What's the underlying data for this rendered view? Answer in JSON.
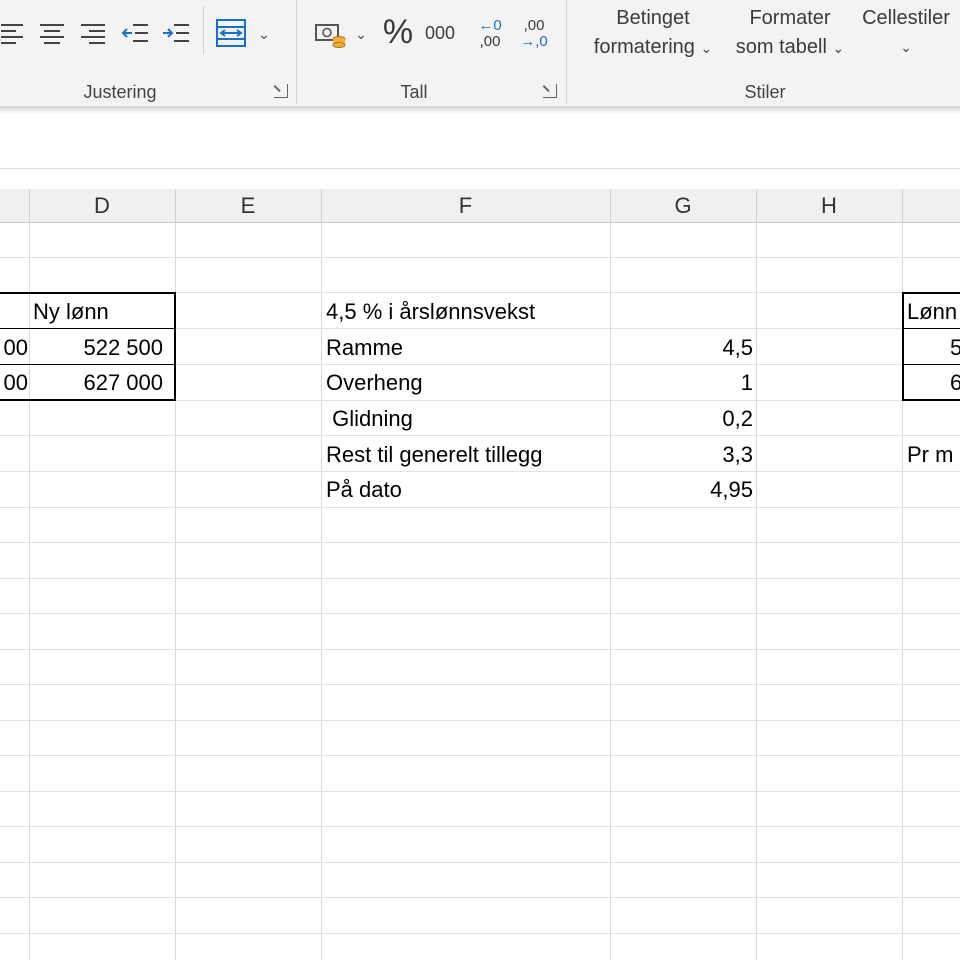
{
  "ribbon": {
    "groups": {
      "justering": "Justering",
      "tall": "Tall",
      "stiler": "Stiler"
    },
    "number_format": {
      "percent": "%",
      "thousands": "000",
      "increase_decimals_top": "←0",
      "increase_decimals_bottom": ",00",
      "decrease_decimals_top": ",00",
      "decrease_decimals_bottom": "→,0"
    },
    "styles": {
      "conditional_line1": "Betinget",
      "conditional_line2": "formatering",
      "as_table_line1": "Formater",
      "as_table_line2": "som tabell",
      "cell_styles": "Cellestiler"
    }
  },
  "columns": [
    "D",
    "E",
    "F",
    "G",
    "H"
  ],
  "sheet": {
    "left_table": {
      "header": "Ny lønn",
      "partial_prev_cells": [
        "00",
        "00"
      ],
      "values": [
        "522 500",
        "627 000"
      ]
    },
    "center": {
      "title": "4,5 % i årslønnsvekst",
      "rows": [
        {
          "label": "Ramme",
          "value": "4,5"
        },
        {
          "label": "Overheng",
          "value": "1"
        },
        {
          "label": " Glidning",
          "value": "0,2"
        },
        {
          "label": "Rest til generelt tillegg",
          "value": "3,3"
        },
        {
          "label": "På dato",
          "value": "4,95"
        }
      ]
    },
    "right_table": {
      "header": "Lønn",
      "values": [
        "5",
        "6"
      ],
      "note": "Pr m"
    }
  },
  "colors": {
    "ribbon_bg": "#f3f3f3",
    "header_bg": "#f0f0f0",
    "gridline": "#d9d9d9",
    "accent_blue": "#1a6fc9"
  }
}
